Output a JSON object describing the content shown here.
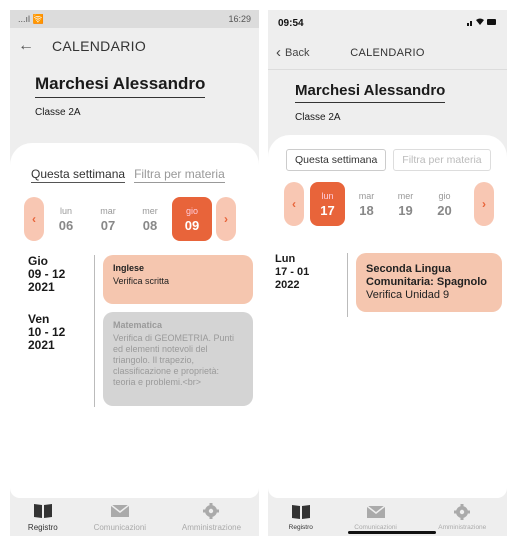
{
  "android": {
    "status": {
      "left": "...ıl 🛜",
      "right": "16:29"
    },
    "header": {
      "title": "CALENDARIO"
    },
    "student": {
      "name": "Marchesi Alessandro",
      "class": "Classe 2A"
    },
    "filters": {
      "week": "Questa settimana",
      "subject": "Filtra per materia"
    },
    "days": [
      {
        "dow": "lun",
        "num": "06"
      },
      {
        "dow": "mar",
        "num": "07"
      },
      {
        "dow": "mer",
        "num": "08"
      },
      {
        "dow": "gio",
        "num": "09",
        "selected": true
      }
    ],
    "events": [
      {
        "date": "Gio\n09 - 12\n2021",
        "subject": "Inglese",
        "desc": "Verifica scritta"
      },
      {
        "date": "Ven\n10 - 12\n2021",
        "subject": "Matematica",
        "desc": "Verifica di GEOMETRIA. Punti ed elementi notevoli del triangolo. Il trapezio, classificazione e proprietà: teoria e problemi.<br>"
      }
    ],
    "tabs": [
      "Registro",
      "Comunicazioni",
      "Amministrazione"
    ]
  },
  "ios": {
    "status": {
      "time": "09:54"
    },
    "header": {
      "back": "Back",
      "title": "CALENDARIO"
    },
    "student": {
      "name": "Marchesi Alessandro",
      "class": "Classe 2A"
    },
    "filters": {
      "week": "Questa settimana",
      "subject": "Filtra per materia"
    },
    "days": [
      {
        "dow": "lun",
        "num": "17",
        "selected": true
      },
      {
        "dow": "mar",
        "num": "18"
      },
      {
        "dow": "mer",
        "num": "19"
      },
      {
        "dow": "gio",
        "num": "20"
      }
    ],
    "events": [
      {
        "date": "Lun\n17 - 01\n2022",
        "subject": "Seconda Lingua Comunitaria: Spagnolo",
        "desc": "Verifica Unidad 9"
      }
    ],
    "tabs": [
      "Registro",
      "Comunicazioni",
      "Amministrazione"
    ]
  },
  "colors": {
    "accent": "#e8643a",
    "accent_light": "#f8c7b3",
    "event_orange": "#f5c6af",
    "event_grey": "#d4d4d4"
  }
}
